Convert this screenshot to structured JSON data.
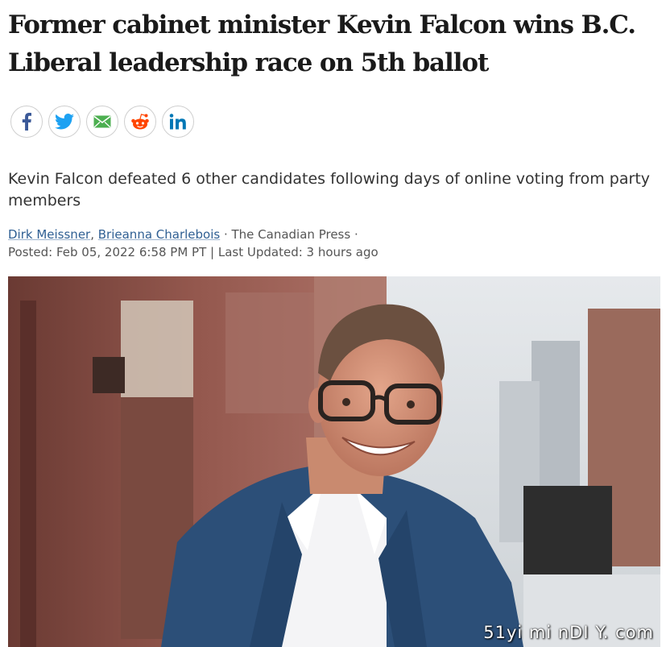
{
  "article": {
    "headline": "Former cabinet minister Kevin Falcon wins B.C. Liberal leadership race on 5th ballot",
    "deck": "Kevin Falcon defeated 6 other candidates following days of online voting from party members",
    "authors": [
      "Dirk Meissner",
      "Brieanna Charlebois"
    ],
    "author_separator": ", ",
    "source": " · The Canadian Press ·",
    "posted": "Posted: Feb 05, 2022 6:58 PM PT | Last Updated: 3 hours ago"
  },
  "share": {
    "buttons": [
      {
        "icon": "facebook-icon",
        "color": "#3b5998"
      },
      {
        "icon": "twitter-icon",
        "color": "#1da1f2"
      },
      {
        "icon": "email-icon",
        "color": "#4caf50"
      },
      {
        "icon": "reddit-icon",
        "color": "#ff4500"
      },
      {
        "icon": "linkedin-icon",
        "color": "#0077b5"
      }
    ]
  },
  "photo": {
    "watermark": "51yi mi nDI Y. com"
  }
}
